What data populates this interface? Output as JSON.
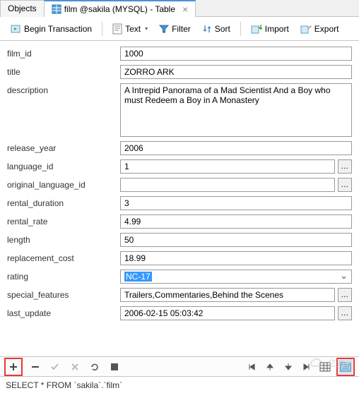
{
  "tabs": {
    "objects": "Objects",
    "current": "film @sakila (MYSQL) - Table"
  },
  "toolbar": {
    "begin_tx": "Begin Transaction",
    "text": "Text",
    "filter": "Filter",
    "sort": "Sort",
    "import": "Import",
    "export": "Export"
  },
  "fields": {
    "film_id": {
      "label": "film_id",
      "value": "1000"
    },
    "title": {
      "label": "title",
      "value": "ZORRO ARK"
    },
    "description": {
      "label": "description",
      "value": "A Intrepid Panorama of a Mad Scientist And a Boy who must Redeem a Boy in A Monastery"
    },
    "release_year": {
      "label": "release_year",
      "value": "2006"
    },
    "language_id": {
      "label": "language_id",
      "value": "1"
    },
    "original_language_id": {
      "label": "original_language_id",
      "value": ""
    },
    "rental_duration": {
      "label": "rental_duration",
      "value": "3"
    },
    "rental_rate": {
      "label": "rental_rate",
      "value": "4.99"
    },
    "length": {
      "label": "length",
      "value": "50"
    },
    "replacement_cost": {
      "label": "replacement_cost",
      "value": "18.99"
    },
    "rating": {
      "label": "rating",
      "value": "NC-17"
    },
    "special_features": {
      "label": "special_features",
      "value": "Trailers,Commentaries,Behind the Scenes"
    },
    "last_update": {
      "label": "last_update",
      "value": "2006-02-15 05:03:42"
    }
  },
  "more_btn": "…",
  "status_sql": "SELECT * FROM `sakila`.`film`",
  "watermark": "亿速云"
}
